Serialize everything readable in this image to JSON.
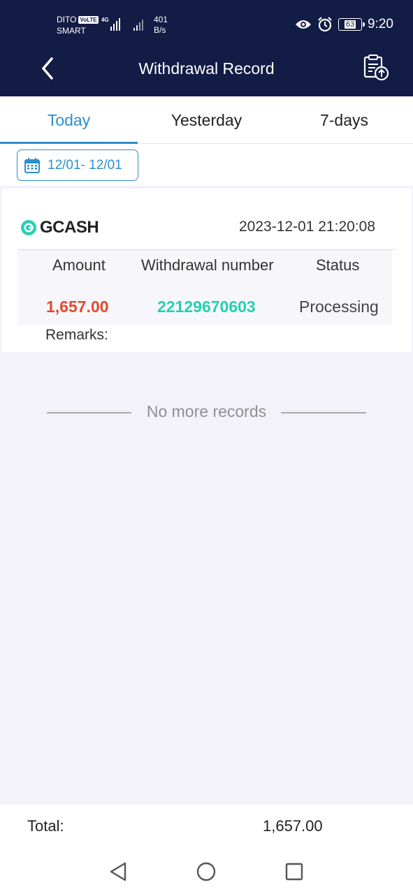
{
  "status_bar": {
    "carrier_1": "DITO",
    "volte": "VoLTE",
    "carrier_2": "SMART",
    "network_type": "4G",
    "speed_value": "401",
    "speed_unit": "B/s",
    "battery": "63",
    "time": "9:20",
    "icons": [
      "eye-icon",
      "alarm-icon",
      "battery-icon"
    ]
  },
  "nav": {
    "title": "Withdrawal Record",
    "back_icon": "chevron-left-icon",
    "action_icon": "clipboard-upload-icon"
  },
  "tabs": [
    {
      "label": "Today",
      "active": true
    },
    {
      "label": "Yesterday",
      "active": false
    },
    {
      "label": "7-days",
      "active": false
    }
  ],
  "date_filter": {
    "icon": "calendar-icon",
    "label": "12/01- 12/01"
  },
  "records": [
    {
      "method": "GCASH",
      "datetime": "2023-12-01 21:20:08",
      "headers": {
        "amount": "Amount",
        "withdrawal_number": "Withdrawal number",
        "status": "Status"
      },
      "amount": "1,657.00",
      "withdrawal_number": "22129670603",
      "status": "Processing",
      "remarks_label": "Remarks:"
    }
  ],
  "no_more_text": "No more records",
  "footer": {
    "total_label": "Total:",
    "total_value": "1,657.00"
  },
  "colors": {
    "header_bg": "#121c45",
    "accent": "#2d8fc9",
    "amount": "#e04a2e",
    "withdrawal_number": "#27d0b2",
    "page_bg": "#f2f2f8"
  }
}
